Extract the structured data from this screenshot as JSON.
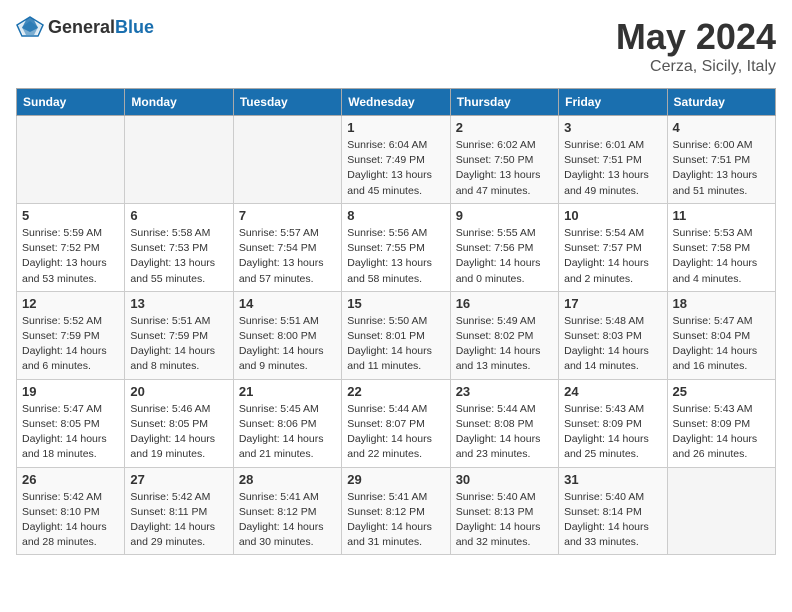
{
  "header": {
    "logo_general": "General",
    "logo_blue": "Blue",
    "month_year": "May 2024",
    "location": "Cerza, Sicily, Italy"
  },
  "weekdays": [
    "Sunday",
    "Monday",
    "Tuesday",
    "Wednesday",
    "Thursday",
    "Friday",
    "Saturday"
  ],
  "weeks": [
    [
      {
        "day": "",
        "info": ""
      },
      {
        "day": "",
        "info": ""
      },
      {
        "day": "",
        "info": ""
      },
      {
        "day": "1",
        "info": "Sunrise: 6:04 AM\nSunset: 7:49 PM\nDaylight: 13 hours\nand 45 minutes."
      },
      {
        "day": "2",
        "info": "Sunrise: 6:02 AM\nSunset: 7:50 PM\nDaylight: 13 hours\nand 47 minutes."
      },
      {
        "day": "3",
        "info": "Sunrise: 6:01 AM\nSunset: 7:51 PM\nDaylight: 13 hours\nand 49 minutes."
      },
      {
        "day": "4",
        "info": "Sunrise: 6:00 AM\nSunset: 7:51 PM\nDaylight: 13 hours\nand 51 minutes."
      }
    ],
    [
      {
        "day": "5",
        "info": "Sunrise: 5:59 AM\nSunset: 7:52 PM\nDaylight: 13 hours\nand 53 minutes."
      },
      {
        "day": "6",
        "info": "Sunrise: 5:58 AM\nSunset: 7:53 PM\nDaylight: 13 hours\nand 55 minutes."
      },
      {
        "day": "7",
        "info": "Sunrise: 5:57 AM\nSunset: 7:54 PM\nDaylight: 13 hours\nand 57 minutes."
      },
      {
        "day": "8",
        "info": "Sunrise: 5:56 AM\nSunset: 7:55 PM\nDaylight: 13 hours\nand 58 minutes."
      },
      {
        "day": "9",
        "info": "Sunrise: 5:55 AM\nSunset: 7:56 PM\nDaylight: 14 hours\nand 0 minutes."
      },
      {
        "day": "10",
        "info": "Sunrise: 5:54 AM\nSunset: 7:57 PM\nDaylight: 14 hours\nand 2 minutes."
      },
      {
        "day": "11",
        "info": "Sunrise: 5:53 AM\nSunset: 7:58 PM\nDaylight: 14 hours\nand 4 minutes."
      }
    ],
    [
      {
        "day": "12",
        "info": "Sunrise: 5:52 AM\nSunset: 7:59 PM\nDaylight: 14 hours\nand 6 minutes."
      },
      {
        "day": "13",
        "info": "Sunrise: 5:51 AM\nSunset: 7:59 PM\nDaylight: 14 hours\nand 8 minutes."
      },
      {
        "day": "14",
        "info": "Sunrise: 5:51 AM\nSunset: 8:00 PM\nDaylight: 14 hours\nand 9 minutes."
      },
      {
        "day": "15",
        "info": "Sunrise: 5:50 AM\nSunset: 8:01 PM\nDaylight: 14 hours\nand 11 minutes."
      },
      {
        "day": "16",
        "info": "Sunrise: 5:49 AM\nSunset: 8:02 PM\nDaylight: 14 hours\nand 13 minutes."
      },
      {
        "day": "17",
        "info": "Sunrise: 5:48 AM\nSunset: 8:03 PM\nDaylight: 14 hours\nand 14 minutes."
      },
      {
        "day": "18",
        "info": "Sunrise: 5:47 AM\nSunset: 8:04 PM\nDaylight: 14 hours\nand 16 minutes."
      }
    ],
    [
      {
        "day": "19",
        "info": "Sunrise: 5:47 AM\nSunset: 8:05 PM\nDaylight: 14 hours\nand 18 minutes."
      },
      {
        "day": "20",
        "info": "Sunrise: 5:46 AM\nSunset: 8:05 PM\nDaylight: 14 hours\nand 19 minutes."
      },
      {
        "day": "21",
        "info": "Sunrise: 5:45 AM\nSunset: 8:06 PM\nDaylight: 14 hours\nand 21 minutes."
      },
      {
        "day": "22",
        "info": "Sunrise: 5:44 AM\nSunset: 8:07 PM\nDaylight: 14 hours\nand 22 minutes."
      },
      {
        "day": "23",
        "info": "Sunrise: 5:44 AM\nSunset: 8:08 PM\nDaylight: 14 hours\nand 23 minutes."
      },
      {
        "day": "24",
        "info": "Sunrise: 5:43 AM\nSunset: 8:09 PM\nDaylight: 14 hours\nand 25 minutes."
      },
      {
        "day": "25",
        "info": "Sunrise: 5:43 AM\nSunset: 8:09 PM\nDaylight: 14 hours\nand 26 minutes."
      }
    ],
    [
      {
        "day": "26",
        "info": "Sunrise: 5:42 AM\nSunset: 8:10 PM\nDaylight: 14 hours\nand 28 minutes."
      },
      {
        "day": "27",
        "info": "Sunrise: 5:42 AM\nSunset: 8:11 PM\nDaylight: 14 hours\nand 29 minutes."
      },
      {
        "day": "28",
        "info": "Sunrise: 5:41 AM\nSunset: 8:12 PM\nDaylight: 14 hours\nand 30 minutes."
      },
      {
        "day": "29",
        "info": "Sunrise: 5:41 AM\nSunset: 8:12 PM\nDaylight: 14 hours\nand 31 minutes."
      },
      {
        "day": "30",
        "info": "Sunrise: 5:40 AM\nSunset: 8:13 PM\nDaylight: 14 hours\nand 32 minutes."
      },
      {
        "day": "31",
        "info": "Sunrise: 5:40 AM\nSunset: 8:14 PM\nDaylight: 14 hours\nand 33 minutes."
      },
      {
        "day": "",
        "info": ""
      }
    ]
  ]
}
